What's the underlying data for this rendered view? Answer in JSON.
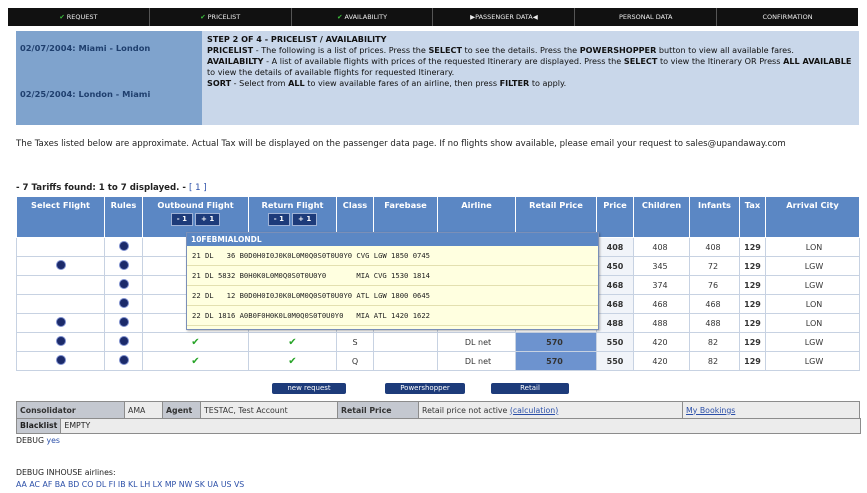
{
  "steps": [
    "REQUEST",
    "PRICELIST",
    "AVAILABILITY",
    "PASSENGER DATA",
    "PERSONAL DATA",
    "CONFIRMATION"
  ],
  "step_checked": [
    true,
    true,
    true,
    false,
    false,
    false
  ],
  "routes": [
    "02/07/2004: Miami - London",
    "02/25/2004: London - Miami"
  ],
  "info": {
    "title": "STEP 2 OF 4 - PRICELIST / AVAILABILITY",
    "pricelist_label": "PRICELIST",
    "pricelist_text": " - The following is a list of prices. Press the ",
    "select_word": "SELECT",
    "pricelist_text2": " to see the details. Press the ",
    "powershopper_word": "POWERSHOPPER",
    "pricelist_text3": " button to view all available fares.",
    "avail_label": "AVAILABILTY",
    "avail_text": " - A list of available flights with prices of the requested Itinerary are displayed. Press the ",
    "avail_text2": " to view the Itinerary OR Press ",
    "all_available_word": "ALL AVAILABLE",
    "avail_text3": " to view the details of available flights for requested Itinerary.",
    "sort_label": "SORT",
    "sort_text": " - Select from ",
    "all_word": "ALL",
    "sort_text2": " to view available fares of an airline, then press ",
    "filter_word": "FILTER",
    "sort_text3": " to apply."
  },
  "note": "The Taxes listed below are approximate. Actual Tax will be displayed on the passenger data page. If no flights show available, please email your request to sales@upandaway.com",
  "found": "- 7 Tariffs found: 1 to 7 displayed. -",
  "page_link": "[ 1 ]",
  "columns": [
    "Select Flight",
    "Rules",
    "Outbound Flight",
    "Return Flight",
    "Class",
    "Farebase",
    "Airline",
    "Retail Price",
    "Price",
    "Children",
    "Infants",
    "Tax",
    "Arrival City"
  ],
  "stepper": {
    "minus": "- 1",
    "plus": "+ 1"
  },
  "rows": [
    {
      "select": false,
      "class": "",
      "farebase": "",
      "airline": "",
      "retail": "",
      "price": "408",
      "children": "408",
      "infants": "408",
      "tax": "129",
      "city": "LON"
    },
    {
      "select": true,
      "class": "",
      "farebase": "",
      "airline": "",
      "retail": "",
      "price": "450",
      "children": "345",
      "infants": "72",
      "tax": "129",
      "city": "LGW"
    },
    {
      "select": false,
      "class": "",
      "farebase": "",
      "airline": "",
      "retail": "",
      "price": "468",
      "children": "374",
      "infants": "76",
      "tax": "129",
      "city": "LGW"
    },
    {
      "select": false,
      "class": "",
      "farebase": "",
      "airline": "",
      "retail": "",
      "price": "468",
      "children": "468",
      "infants": "468",
      "tax": "129",
      "city": "LON"
    },
    {
      "select": true,
      "class": "",
      "farebase": "",
      "airline": "",
      "retail": "",
      "price": "488",
      "children": "488",
      "infants": "488",
      "tax": "129",
      "city": "LON"
    },
    {
      "select": true,
      "class": "S",
      "farebase": "",
      "airline": "DL net",
      "retail": "570",
      "price": "550",
      "children": "420",
      "infants": "82",
      "tax": "129",
      "city": "LGW"
    },
    {
      "select": true,
      "class": "Q",
      "farebase": "",
      "airline": "DL net",
      "retail": "570",
      "price": "550",
      "children": "420",
      "infants": "82",
      "tax": "129",
      "city": "LGW"
    }
  ],
  "popup": {
    "head": "10FEBMIALONDL",
    "lines": [
      "21 DL   36 B0D0H0I0J0K0L0M0Q0S0T0U0Y0 CVG LGW 1850 0745",
      "21 DL 5832 B0H0K0L0M0Q0S0T0U0Y0       MIA CVG 1530 1814",
      "22 DL   12 B0D0H0I0J0K0L0M0Q0S0T0U0Y0 ATL LGW 1800 0645",
      "22 DL 1816 A0B0F0H0K0L0M0Q0S0T0U0Y0   MIA ATL 1420 1622"
    ]
  },
  "buttons": [
    "new request",
    "Powershopper",
    "Retail"
  ],
  "consolidator": {
    "label": "Consolidator",
    "value": "AMA",
    "agent_label": "Agent",
    "agent_value": "TESTAC, Test Account",
    "retail_label": "Retail Price",
    "retail_value": "Retail price not active ",
    "calc_link": "(calculation)",
    "bookings": "My Bookings"
  },
  "blacklist": {
    "label": "Blacklist",
    "value": "EMPTY"
  },
  "debug": {
    "label": "DEBUG ",
    "link": "yes"
  },
  "debug2": "DEBUG INHOUSE airlines:",
  "airlines": "AA AC AF BA BD CO DL FI IB KL LH LX MP NW SK UA US VS"
}
